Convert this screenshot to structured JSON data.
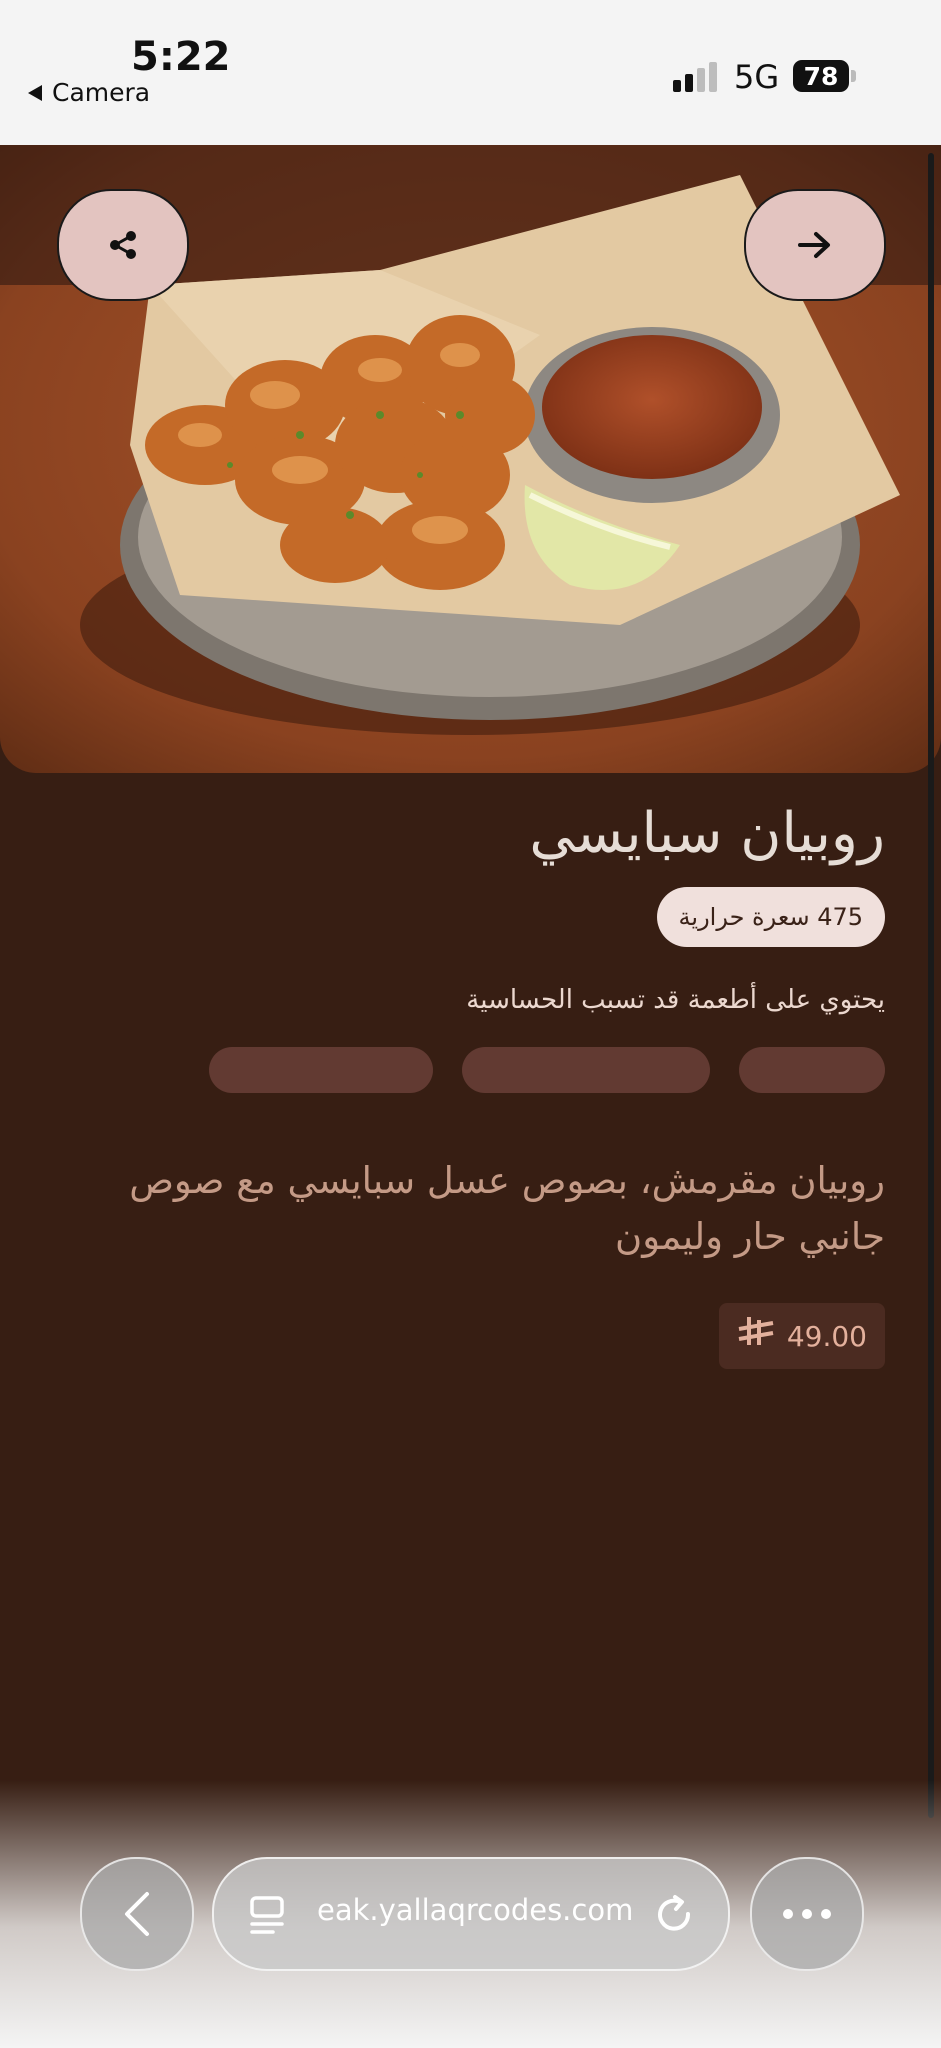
{
  "status_bar": {
    "time": "5:22",
    "back_app": "Camera",
    "network": "5G",
    "battery": "78"
  },
  "item": {
    "title": "روبيان سبايسي",
    "calories": "475 سعرة حرارية",
    "allergen_note": "يحتوي على أطعمة قد تسبب الحساسية",
    "description": "روبيان مقرمش، بصوص عسل سبايسي مع صوص جانبي حار وليمون",
    "price": "49.00",
    "currency_symbol": "⃁"
  },
  "browser": {
    "url": "eak.yallaqrcodes.com"
  },
  "colors": {
    "page_background": "#371e13",
    "button_pink": "#e3c4c0",
    "chip": "#623a32",
    "description_text": "#c49a86"
  },
  "icons": [
    "share-icon",
    "arrow-right-icon",
    "chevron-left-icon",
    "tabs-icon",
    "reload-icon",
    "more-icon"
  ]
}
